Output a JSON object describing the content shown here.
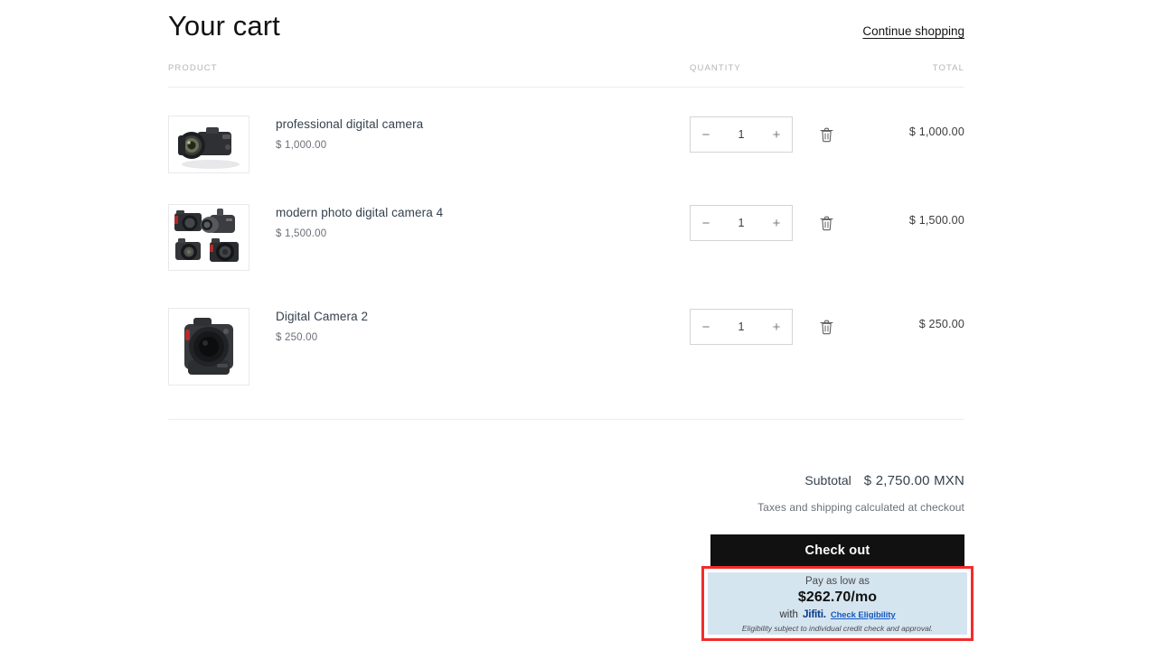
{
  "header": {
    "title": "Your cart",
    "continue_shopping": "Continue shopping"
  },
  "table": {
    "col_product": "PRODUCT",
    "col_quantity": "QUANTITY",
    "col_total": "TOTAL"
  },
  "items": [
    {
      "name": "professional digital camera",
      "unit_price": "$ 1,000.00",
      "quantity": "1",
      "line_total": "$ 1,000.00",
      "decrease_label": "−",
      "increase_label": "+",
      "remove_label": "trash-icon",
      "image_alt": "professional-digital-camera-thumbnail"
    },
    {
      "name": "modern photo digital camera 4",
      "unit_price": "$ 1,500.00",
      "quantity": "1",
      "line_total": "$ 1,500.00",
      "decrease_label": "−",
      "increase_label": "+",
      "remove_label": "trash-icon",
      "image_alt": "modern-photo-digital-camera-4-thumbnail"
    },
    {
      "name": "Digital Camera 2",
      "unit_price": "$ 250.00",
      "quantity": "1",
      "line_total": "$ 250.00",
      "decrease_label": "−",
      "increase_label": "+",
      "remove_label": "trash-icon",
      "image_alt": "digital-camera-2-thumbnail"
    }
  ],
  "summary": {
    "subtotal_label": "Subtotal",
    "subtotal_value": "$ 2,750.00 MXN",
    "tax_note": "Taxes and shipping calculated at checkout",
    "checkout_label": "Check out"
  },
  "financing": {
    "pay_as_low_as": "Pay as low as",
    "amount": "$262.70/mo",
    "with_text": "with",
    "provider": "Jifiti.",
    "check_eligibility": "Check Eligibility",
    "disclaimer": "Eligibility subject to individual credit check and approval.",
    "panel_color": "#d5e5f0",
    "highlight_color": "#f42b2b",
    "link_color": "#1558c0",
    "logo_color": "#0b3c8c"
  }
}
